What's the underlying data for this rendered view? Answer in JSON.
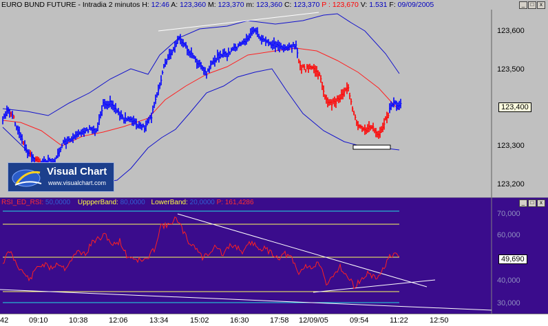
{
  "top_header": {
    "instrument": "EURO BUND FUTURE - Intradia 2 minutos",
    "h_label": "H:",
    "h_value": "12:46",
    "a_label": "A:",
    "a_value": "123,360",
    "mx_label": "M:",
    "mx_value": "123,370",
    "mn_label": "m:",
    "mn_value": "123,360",
    "c_label": "C:",
    "c_value": "123,370",
    "p_label": "P :",
    "p_value": "123,670",
    "v_label": "V:",
    "v_value": "1.531",
    "f_label": "F:",
    "f_value": "09/09/2005"
  },
  "price_axis": [
    "123,600",
    "123,500",
    "123,300",
    "123,200"
  ],
  "current_price": "123,400",
  "rsi_header": {
    "rsi_label": "RSI_ED_RSI:",
    "rsi_value": "50,0000",
    "upper_label": "UppperBand:",
    "upper_value": "80,0000",
    "lower_label": "LowerBand:",
    "lower_value": "20,0000",
    "p_label": "P:",
    "p_value": "161,4286"
  },
  "rsi_axis": [
    "70,000",
    "60,000",
    "40,000",
    "30,000"
  ],
  "rsi_current": "49,690",
  "time_axis": [
    "42",
    "09:10",
    "10:38",
    "12:06",
    "13:34",
    "15:02",
    "16:30",
    "17:58",
    "12/09/05",
    "09:54",
    "11:22",
    "12:50"
  ],
  "logo": {
    "title": "Visual Chart",
    "url": "www.visualchart.com"
  },
  "window_buttons": [
    "_",
    "□",
    "x"
  ],
  "colors": {
    "price_bg": "#c0c0c0",
    "rsi_bg": "#3a0c8c",
    "price_up": "#0000ff",
    "price_down": "#ff0000",
    "bollinger": "#1010cc",
    "moving_avg": "#ff2020",
    "rsi_line": "#ff2020",
    "band_lines": "#ffff60",
    "trendline": "#ffffff"
  }
}
